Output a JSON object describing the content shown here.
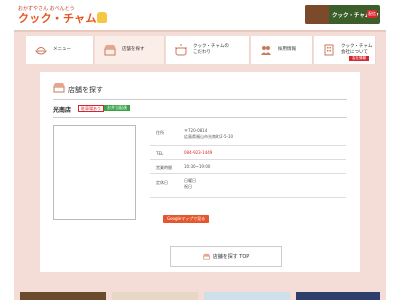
{
  "header": {
    "logo_sub": "おかずやさん おべんとう",
    "logo": "クック・チャム",
    "banner_text": "クック・チャムTV",
    "banner_tag": "配信"
  },
  "nav": {
    "items": [
      {
        "label": "メニュー",
        "icon": "bowl-icon"
      },
      {
        "label": "店舗を探す",
        "icon": "shop-icon"
      },
      {
        "label": "クック・チャムの\nこだわり",
        "icon": "pot-icon"
      },
      {
        "label": "採用情報",
        "icon": "people-icon"
      },
      {
        "label": "クック・チャム\n会社について",
        "icon": "building-icon"
      }
    ],
    "badge": "会社情報"
  },
  "page": {
    "title": "店舗を探す",
    "store_name": "光南店",
    "badge_red": "駐車場あり",
    "badge_green": "お弁当配達",
    "info": [
      {
        "key": "住所",
        "value": "〒720-0814\n広島県福山市光南町2-5-10"
      },
      {
        "key": "TEL",
        "value": "084-923-1449"
      },
      {
        "key": "営業時間",
        "value": "10:30~19:00"
      },
      {
        "key": "定休日",
        "value": "日曜日\n祝日"
      }
    ],
    "map_button": "Googleマップで見る",
    "top_button": "店舗を探す TOP"
  },
  "colors": {
    "brand_orange": "#e8541c",
    "accent_red": "#d7262e",
    "nav_background": "#f3ddd6",
    "badge_green": "#3aa348"
  }
}
